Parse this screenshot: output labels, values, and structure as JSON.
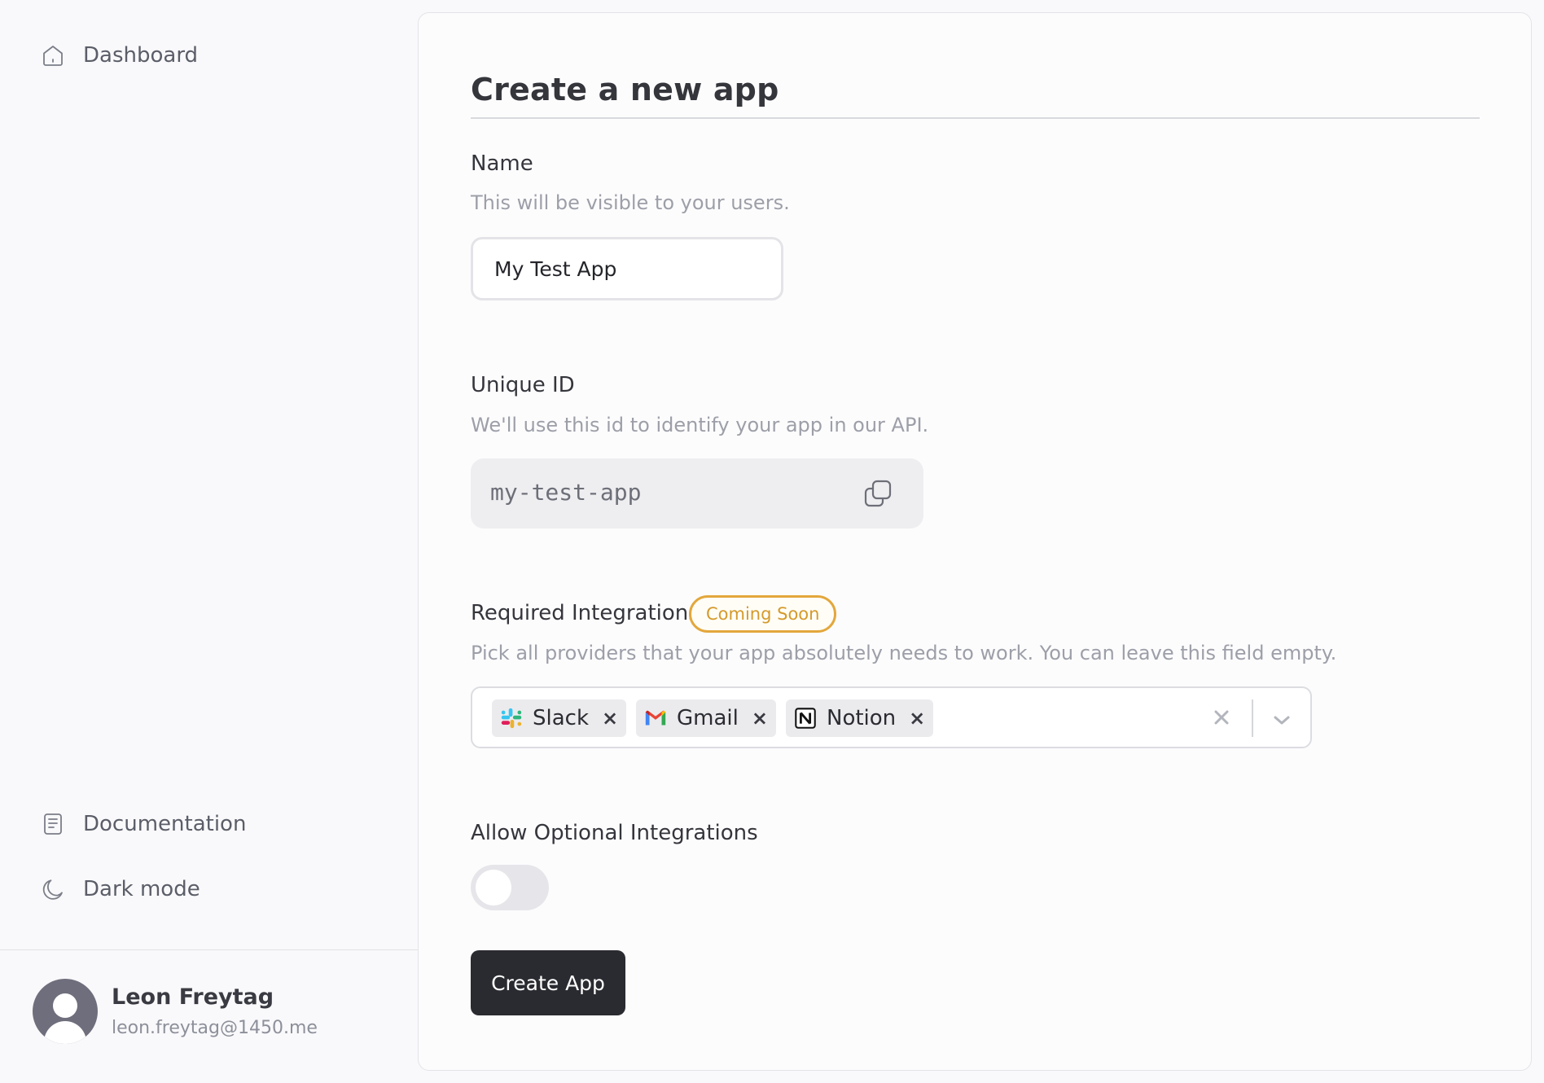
{
  "sidebar": {
    "items": [
      {
        "label": "Dashboard",
        "icon": "home-icon"
      },
      {
        "label": "Documentation",
        "icon": "document-icon"
      },
      {
        "label": "Dark mode",
        "icon": "moon-icon"
      }
    ],
    "user": {
      "name": "Leon Freytag",
      "email": "leon.freytag@1450.me",
      "icon": "user-avatar"
    }
  },
  "main": {
    "title": "Create a new app",
    "name_field": {
      "label": "Name",
      "help": "This will be visible to your users.",
      "value": "My Test App"
    },
    "id_field": {
      "label": "Unique ID",
      "help": "We'll use this id to identify your app in our API.",
      "value": "my-test-app",
      "icon": "copy-icon"
    },
    "integrations": {
      "label": "Required Integrations",
      "badge": "Coming Soon",
      "help": "Pick all providers that your app absolutely needs to work. You can leave this field empty.",
      "selected": [
        {
          "label": "Slack",
          "icon": "slack-logo"
        },
        {
          "label": "Gmail",
          "icon": "gmail-logo"
        },
        {
          "label": "Notion",
          "icon": "notion-logo"
        }
      ],
      "remove_glyph": "×"
    },
    "optional": {
      "label": "Allow Optional Integrations",
      "enabled": false
    },
    "submit_label": "Create App"
  },
  "colors": {
    "accent": "#2a2b30",
    "badge": "#e3a73c",
    "background": "#f9f9fb"
  }
}
